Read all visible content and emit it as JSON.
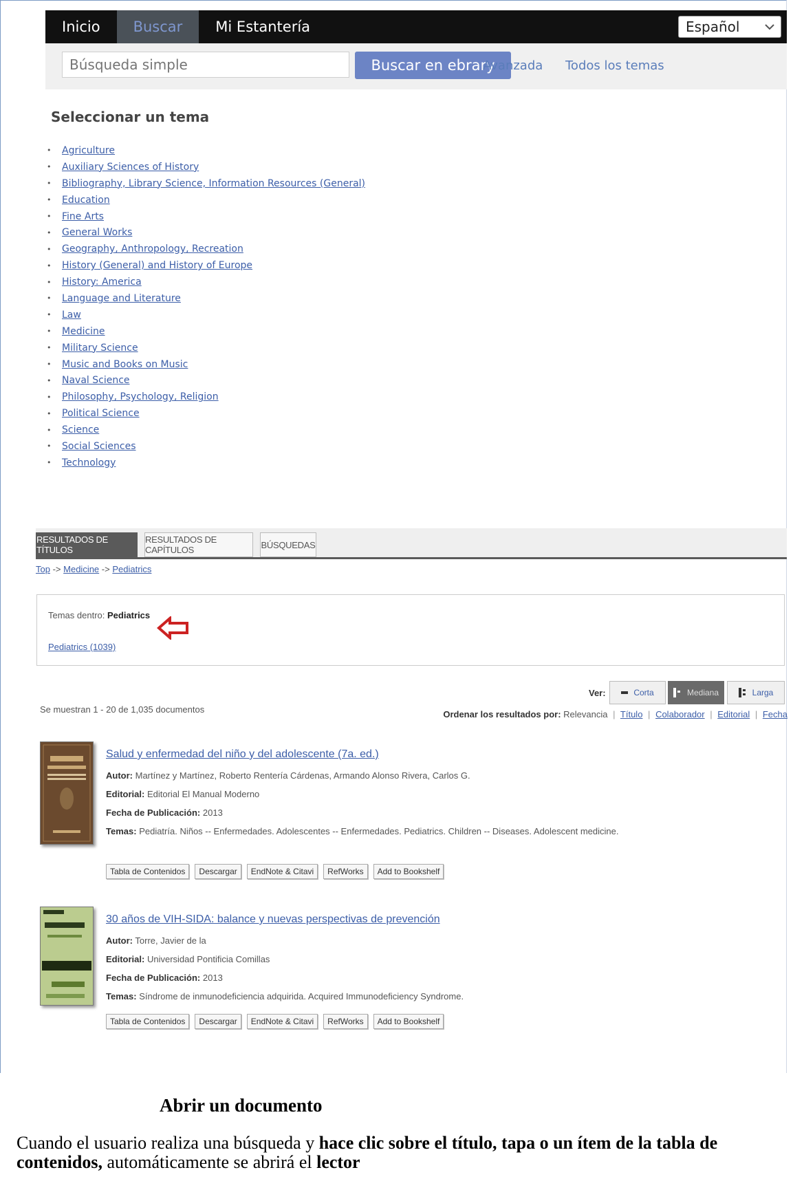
{
  "nav": {
    "tabs": [
      {
        "label": "Inicio",
        "active": false
      },
      {
        "label": "Buscar",
        "active": true
      },
      {
        "label": "Mi Estantería",
        "active": false
      }
    ],
    "language": "Español"
  },
  "search": {
    "placeholder": "Búsqueda simple",
    "button_label": "Buscar en ebrary",
    "advanced_label": "Avanzada",
    "all_topics_label": "Todos los temas"
  },
  "topics": {
    "heading": "Seleccionar un tema",
    "items": [
      "Agriculture",
      "Auxiliary Sciences of History",
      "Bibliography, Library Science, Information Resources (General)",
      "Education",
      "Fine Arts",
      "General Works",
      "Geography, Anthropology, Recreation",
      "History (General) and History of Europe",
      "History: America",
      "Language and Literature",
      "Law",
      "Medicine",
      "Military Science",
      "Music and Books on Music",
      "Naval Science",
      "Philosophy, Psychology, Religion",
      "Political Science",
      "Science",
      "Social Sciences",
      "Technology"
    ]
  },
  "results": {
    "tabs": [
      "RESULTADOS DE TÍTULOS",
      "RESULTADOS DE CAPÍTULOS",
      "BÚSQUEDAS"
    ],
    "breadcrumb": [
      "Top",
      "Medicine",
      "Pediatrics"
    ],
    "breadcrumb_sep": "->",
    "subjects_label": "Temas dentro:",
    "subjects_value": "Pediatrics",
    "subject_link": "Pediatrics (1039)",
    "view_label": "Ver:",
    "view_options": [
      "Corta",
      "Mediana",
      "Larga"
    ],
    "active_view": "Mediana",
    "count_text": "Se muestran 1 - 20 de 1,035 documentos",
    "sort_label": "Ordenar los resultados por:",
    "sort_options": [
      "Relevancia",
      "Título",
      "Colaborador",
      "Editorial",
      "Fecha"
    ],
    "labels": {
      "author": "Autor:",
      "publisher": "Editorial:",
      "date": "Fecha de Publicación:",
      "subjects": "Temas:"
    },
    "actions": [
      "Tabla de Contenidos",
      "Descargar",
      "EndNote & Citavi",
      "RefWorks",
      "Add to Bookshelf"
    ],
    "items": [
      {
        "title": "Salud y enfermedad del niño y del adolescente (7a. ed.)",
        "author": "Martínez y Martínez, Roberto  Rentería Cárdenas, Armando  Alonso Rivera, Carlos G.",
        "publisher": "Editorial El Manual Moderno",
        "date": "2013",
        "subjects": "Pediatría.  Niños -- Enfermedades.  Adolescentes -- Enfermedades.  Pediatrics.  Children -- Diseases.  Adolescent medicine.",
        "cover_color": "#6b4a2e"
      },
      {
        "title": "30 años de VIH-SIDA: balance y nuevas perspectivas de prevención",
        "author": "Torre, Javier de la",
        "publisher": "Universidad Pontificia Comillas",
        "date": "2013",
        "subjects": "Síndrome de inmunodeficiencia adquirida.  Acquired Immunodeficiency Syndrome.",
        "cover_color": "#9fb86a"
      }
    ]
  },
  "doc": {
    "heading": "Abrir un documento",
    "para_1": "Cuando el usuario realiza una búsqueda y ",
    "para_2": "hace clic sobre el título, tapa o un ítem de la tabla de contenidos,",
    "para_3": " automáticamente se abrirá  el ",
    "para_4": "lector"
  },
  "colors": {
    "accent": "#6c84c5",
    "link": "#3c5ea8",
    "nav_bg": "#111111",
    "arrow": "#cc2222"
  }
}
